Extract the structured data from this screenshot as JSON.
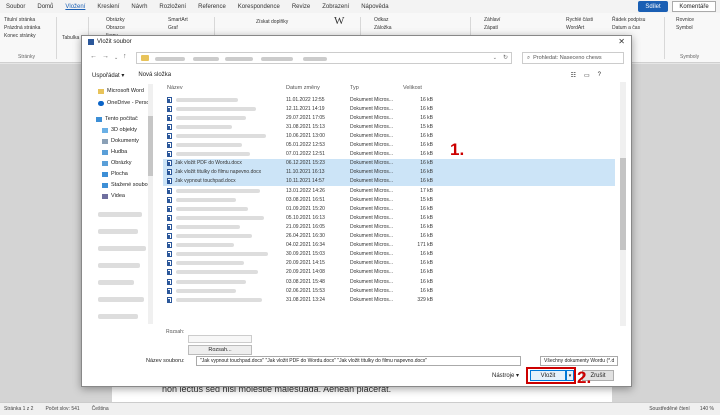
{
  "ribbon": {
    "tabs": [
      "Soubor",
      "Domů",
      "Vložení",
      "Kreslení",
      "Návrh",
      "Rozložení",
      "Reference",
      "Korespondence",
      "Revize",
      "Zobrazení",
      "Nápověda"
    ],
    "active_tab": "Vložení",
    "share_label": "Sdílet",
    "comments_label": "Komentáře",
    "items": {
      "title_page": "Titulní stránka",
      "blank_page": "Prázdná stránka",
      "page_break": "Konec stránky",
      "pages_group": "Stránky",
      "table": "Tabulka",
      "images": "Obrázky",
      "shapes": "Obrazce",
      "icons": "Ikony",
      "smartart": "SmartArt",
      "chart": "Graf",
      "get_addins": "Získat doplňky",
      "wiki_icon": "W",
      "link": "Odkaz",
      "bookmark": "Záložka",
      "header": "Záhlaví",
      "footer": "Zápatí",
      "quick_parts": "Rychlé části",
      "wordart": "WordArt",
      "signature_line": "Řádek podpisu",
      "date_time": "Datum a čas",
      "equation": "Rovnice",
      "symbol": "Symbol",
      "symbols_group": "Symboly"
    }
  },
  "dialog": {
    "title": "Vložit soubor",
    "search_placeholder": "Prohledat: Naseceno chews",
    "organize_label": "Uspořádat",
    "new_folder_label": "Nová složka",
    "sidebar": {
      "items": [
        "Microsoft Word",
        "OneDrive - Person",
        "Tento počítač",
        "3D objekty",
        "Dokumenty",
        "Hudba",
        "Obrázky",
        "Plocha",
        "Stažené soubory",
        "Videa"
      ]
    },
    "columns": {
      "name": "Název",
      "date": "Datum změny",
      "type": "Typ",
      "size": "Velikost"
    },
    "rows": [
      {
        "name": "",
        "date": "11.01.2022 12:55",
        "type": "Dokument Micros...",
        "size": "16 kB",
        "selected": false
      },
      {
        "name": "",
        "date": "12.11.2021 14:19",
        "type": "Dokument Micros...",
        "size": "16 kB",
        "selected": false
      },
      {
        "name": "",
        "date": "29.07.2021 17:05",
        "type": "Dokument Micros...",
        "size": "16 kB",
        "selected": false
      },
      {
        "name": "",
        "date": "31.08.2021 15:13",
        "type": "Dokument Micros...",
        "size": "15 kB",
        "selected": false
      },
      {
        "name": "",
        "date": "10.06.2021 13:00",
        "type": "Dokument Micros...",
        "size": "16 kB",
        "selected": false
      },
      {
        "name": "",
        "date": "05.01.2022 12:53",
        "type": "Dokument Micros...",
        "size": "16 kB",
        "selected": false
      },
      {
        "name": "",
        "date": "07.01.2022 12:51",
        "type": "Dokument Micros...",
        "size": "16 kB",
        "selected": false
      },
      {
        "name": "Jak vložit PDF do Wordu.docx",
        "date": "06.12.2021 15:23",
        "type": "Dokument Micros...",
        "size": "16 kB",
        "selected": true
      },
      {
        "name": "Jak vložit titulky do filmu napevno.docx",
        "date": "11.10.2021 16:13",
        "type": "Dokument Micros...",
        "size": "16 kB",
        "selected": true
      },
      {
        "name": "Jak vypnout touchpad.docx",
        "date": "10.11.2021 14:57",
        "type": "Dokument Micros...",
        "size": "16 kB",
        "selected": true
      },
      {
        "name": "",
        "date": "13.01.2022 14:26",
        "type": "Dokument Micros...",
        "size": "17 kB",
        "selected": false
      },
      {
        "name": "",
        "date": "03.08.2021 16:51",
        "type": "Dokument Micros...",
        "size": "15 kB",
        "selected": false
      },
      {
        "name": "",
        "date": "01.09.2021 15:20",
        "type": "Dokument Micros...",
        "size": "16 kB",
        "selected": false
      },
      {
        "name": "",
        "date": "05.10.2021 16:13",
        "type": "Dokument Micros...",
        "size": "16 kB",
        "selected": false
      },
      {
        "name": "",
        "date": "21.09.2021 16:05",
        "type": "Dokument Micros...",
        "size": "16 kB",
        "selected": false
      },
      {
        "name": "",
        "date": "26.04.2021 16:30",
        "type": "Dokument Micros...",
        "size": "16 kB",
        "selected": false
      },
      {
        "name": "",
        "date": "04.02.2021 16:34",
        "type": "Dokument Micros...",
        "size": "171 kB",
        "selected": false
      },
      {
        "name": "",
        "date": "30.09.2021 15:03",
        "type": "Dokument Micros...",
        "size": "16 kB",
        "selected": false
      },
      {
        "name": "",
        "date": "20.09.2021 14:15",
        "type": "Dokument Micros...",
        "size": "16 kB",
        "selected": false
      },
      {
        "name": "",
        "date": "20.09.2021 14:08",
        "type": "Dokument Micros...",
        "size": "16 kB",
        "selected": false
      },
      {
        "name": "",
        "date": "03.08.2021 15:48",
        "type": "Dokument Micros...",
        "size": "16 kB",
        "selected": false
      },
      {
        "name": "",
        "date": "02.06.2021 15:53",
        "type": "Dokument Micros...",
        "size": "16 kB",
        "selected": false
      },
      {
        "name": "",
        "date": "31.08.2021 13:24",
        "type": "Dokument Micros...",
        "size": "329 kB",
        "selected": false
      }
    ],
    "details_label": "Rozsah:",
    "range_button": "Rozsah...",
    "filename_label": "Název souboru:",
    "filename_value": "\"Jak vypnout touchpad.docx\" \"Jak vložit PDF do Wordu.docx\" \"Jak vložit titulky do filmu napevno.docx\"",
    "filetype_value": "Všechny dokumenty Wordu (*.d",
    "tools_label": "Nástroje",
    "insert_label": "Vložit",
    "cancel_label": "Zrušit"
  },
  "annotations": {
    "step1": "1.",
    "step2": "2.",
    "highlight_color": "#cc0000"
  },
  "document": {
    "text": "non lectus sed nisi molestie malesuada. Aenean placerat."
  },
  "status": {
    "page": "Stránka 1 z 2",
    "words": "Počet slov: 541",
    "language": "Čeština",
    "focus": "Soustředěné čtení",
    "zoom": "140 %"
  }
}
